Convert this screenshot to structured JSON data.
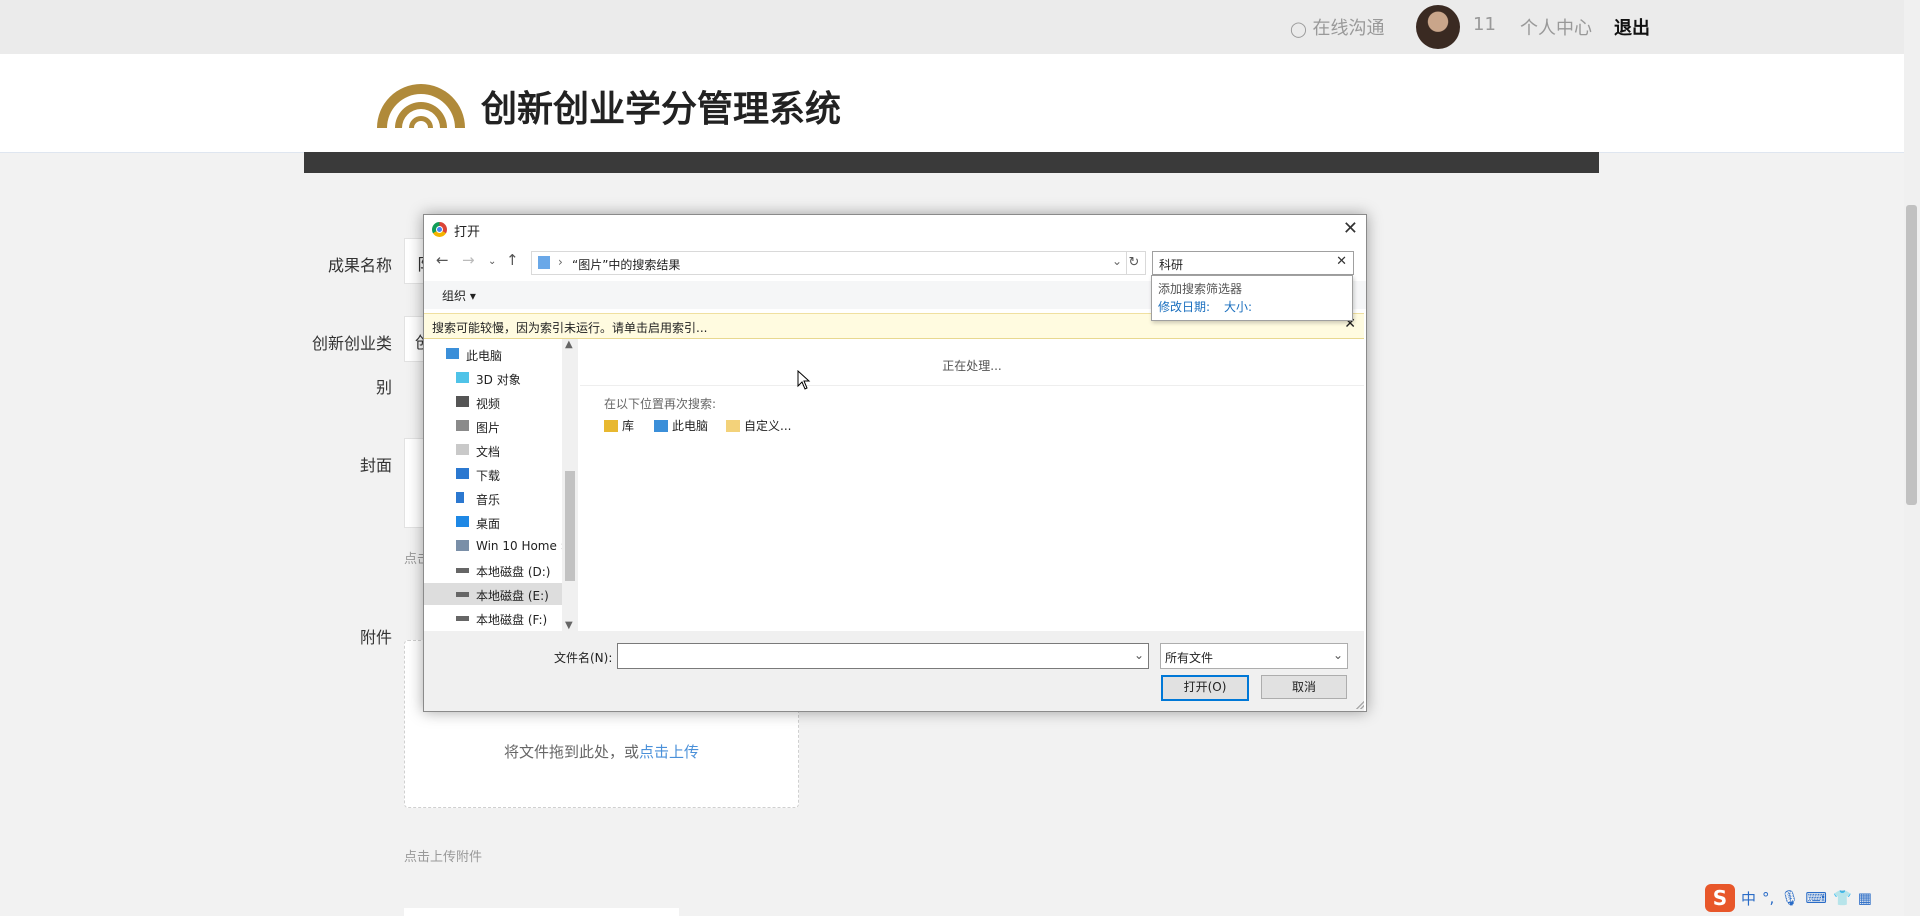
{
  "topbar": {
    "online_chat": "在线沟通",
    "user_id": "11",
    "profile": "个人中心",
    "logout": "退出"
  },
  "header": {
    "site_title": "创新创业学分管理系统"
  },
  "form": {
    "label_name": "成果名称",
    "name_value_partial": "阝",
    "label_category_line1": "创新创业类",
    "label_category_line2": "别",
    "category_value_partial": "创",
    "label_cover": "封面",
    "cover_hint_partial": "点击",
    "label_attachment": "附件",
    "drop_text": "将文件拖到此处，或",
    "drop_link": "点击上传",
    "attachment_hint": "点击上传附件"
  },
  "ime": {
    "logo": "S",
    "mode": "中"
  },
  "dialog": {
    "title": "打开",
    "address": "“图片”中的搜索结果",
    "search_value": "科研",
    "filter_title": "添加搜索筛选器",
    "filter_date": "修改日期:",
    "filter_size": "大小:",
    "organize": "组织 ▾",
    "info_text": "搜索可能较慢，因为索引未运行。请单击启用索引...",
    "nav_items": [
      {
        "label": "此电脑"
      },
      {
        "label": "3D 对象"
      },
      {
        "label": "视频"
      },
      {
        "label": "图片"
      },
      {
        "label": "文档"
      },
      {
        "label": "下载"
      },
      {
        "label": "音乐"
      },
      {
        "label": "桌面"
      },
      {
        "label": "Win 10 Home ›"
      },
      {
        "label": "本地磁盘 (D:)"
      },
      {
        "label": "本地磁盘 (E:)"
      },
      {
        "label": "本地磁盘 (F:)"
      }
    ],
    "processing": "正在处理...",
    "search_again": "在以下位置再次搜索:",
    "locations": [
      "库",
      "此电脑",
      "自定义..."
    ],
    "filename_label": "文件名(N):",
    "filename_value": "",
    "filetype_value": "所有文件",
    "open_button": "打开(O)",
    "cancel_button": "取消"
  }
}
